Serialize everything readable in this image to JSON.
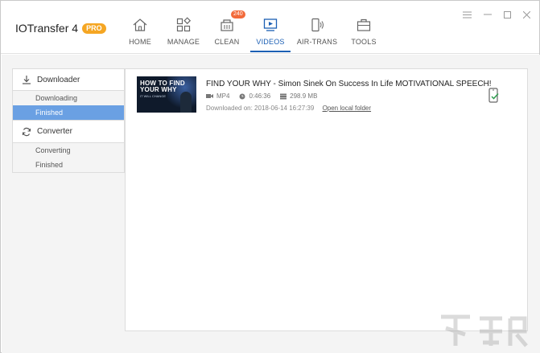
{
  "app": {
    "name": "IOTransfer 4",
    "badge": "PRO"
  },
  "nav": {
    "tabs": [
      {
        "id": "home",
        "label": "HOME",
        "icon": "home-icon"
      },
      {
        "id": "manage",
        "label": "MANAGE",
        "icon": "grid-icon"
      },
      {
        "id": "clean",
        "label": "CLEAN",
        "icon": "clean-icon",
        "badge": "240"
      },
      {
        "id": "videos",
        "label": "VIDEOS",
        "icon": "video-icon",
        "active": true
      },
      {
        "id": "airtrans",
        "label": "AIR-TRANS",
        "icon": "wireless-phone-icon"
      },
      {
        "id": "tools",
        "label": "TOOLS",
        "icon": "toolbox-icon"
      }
    ]
  },
  "sidebar": {
    "downloader": {
      "label": "Downloader",
      "items": [
        "Downloading",
        "Finished"
      ],
      "active": "Finished"
    },
    "converter": {
      "label": "Converter",
      "items": [
        "Converting",
        "Finished"
      ]
    }
  },
  "video": {
    "title": "FIND YOUR WHY - Simon Sinek On Success In Life MOTIVATIONAL SPEECH!",
    "format": "MP4",
    "duration": "0:46:36",
    "size": "298.9 MB",
    "downloaded_label": "Downloaded on: 2018-06-14 16:27:39",
    "open_folder": "Open local folder",
    "thumb_line1": "HOW TO FIND",
    "thumb_line2": "YOUR WHY",
    "thumb_line3": "IT WILL CHANGE"
  },
  "colors": {
    "accent": "#1b5fb4",
    "selected": "#6aa0e3",
    "badge": "#f26a3a",
    "pro": "#f5a623"
  }
}
